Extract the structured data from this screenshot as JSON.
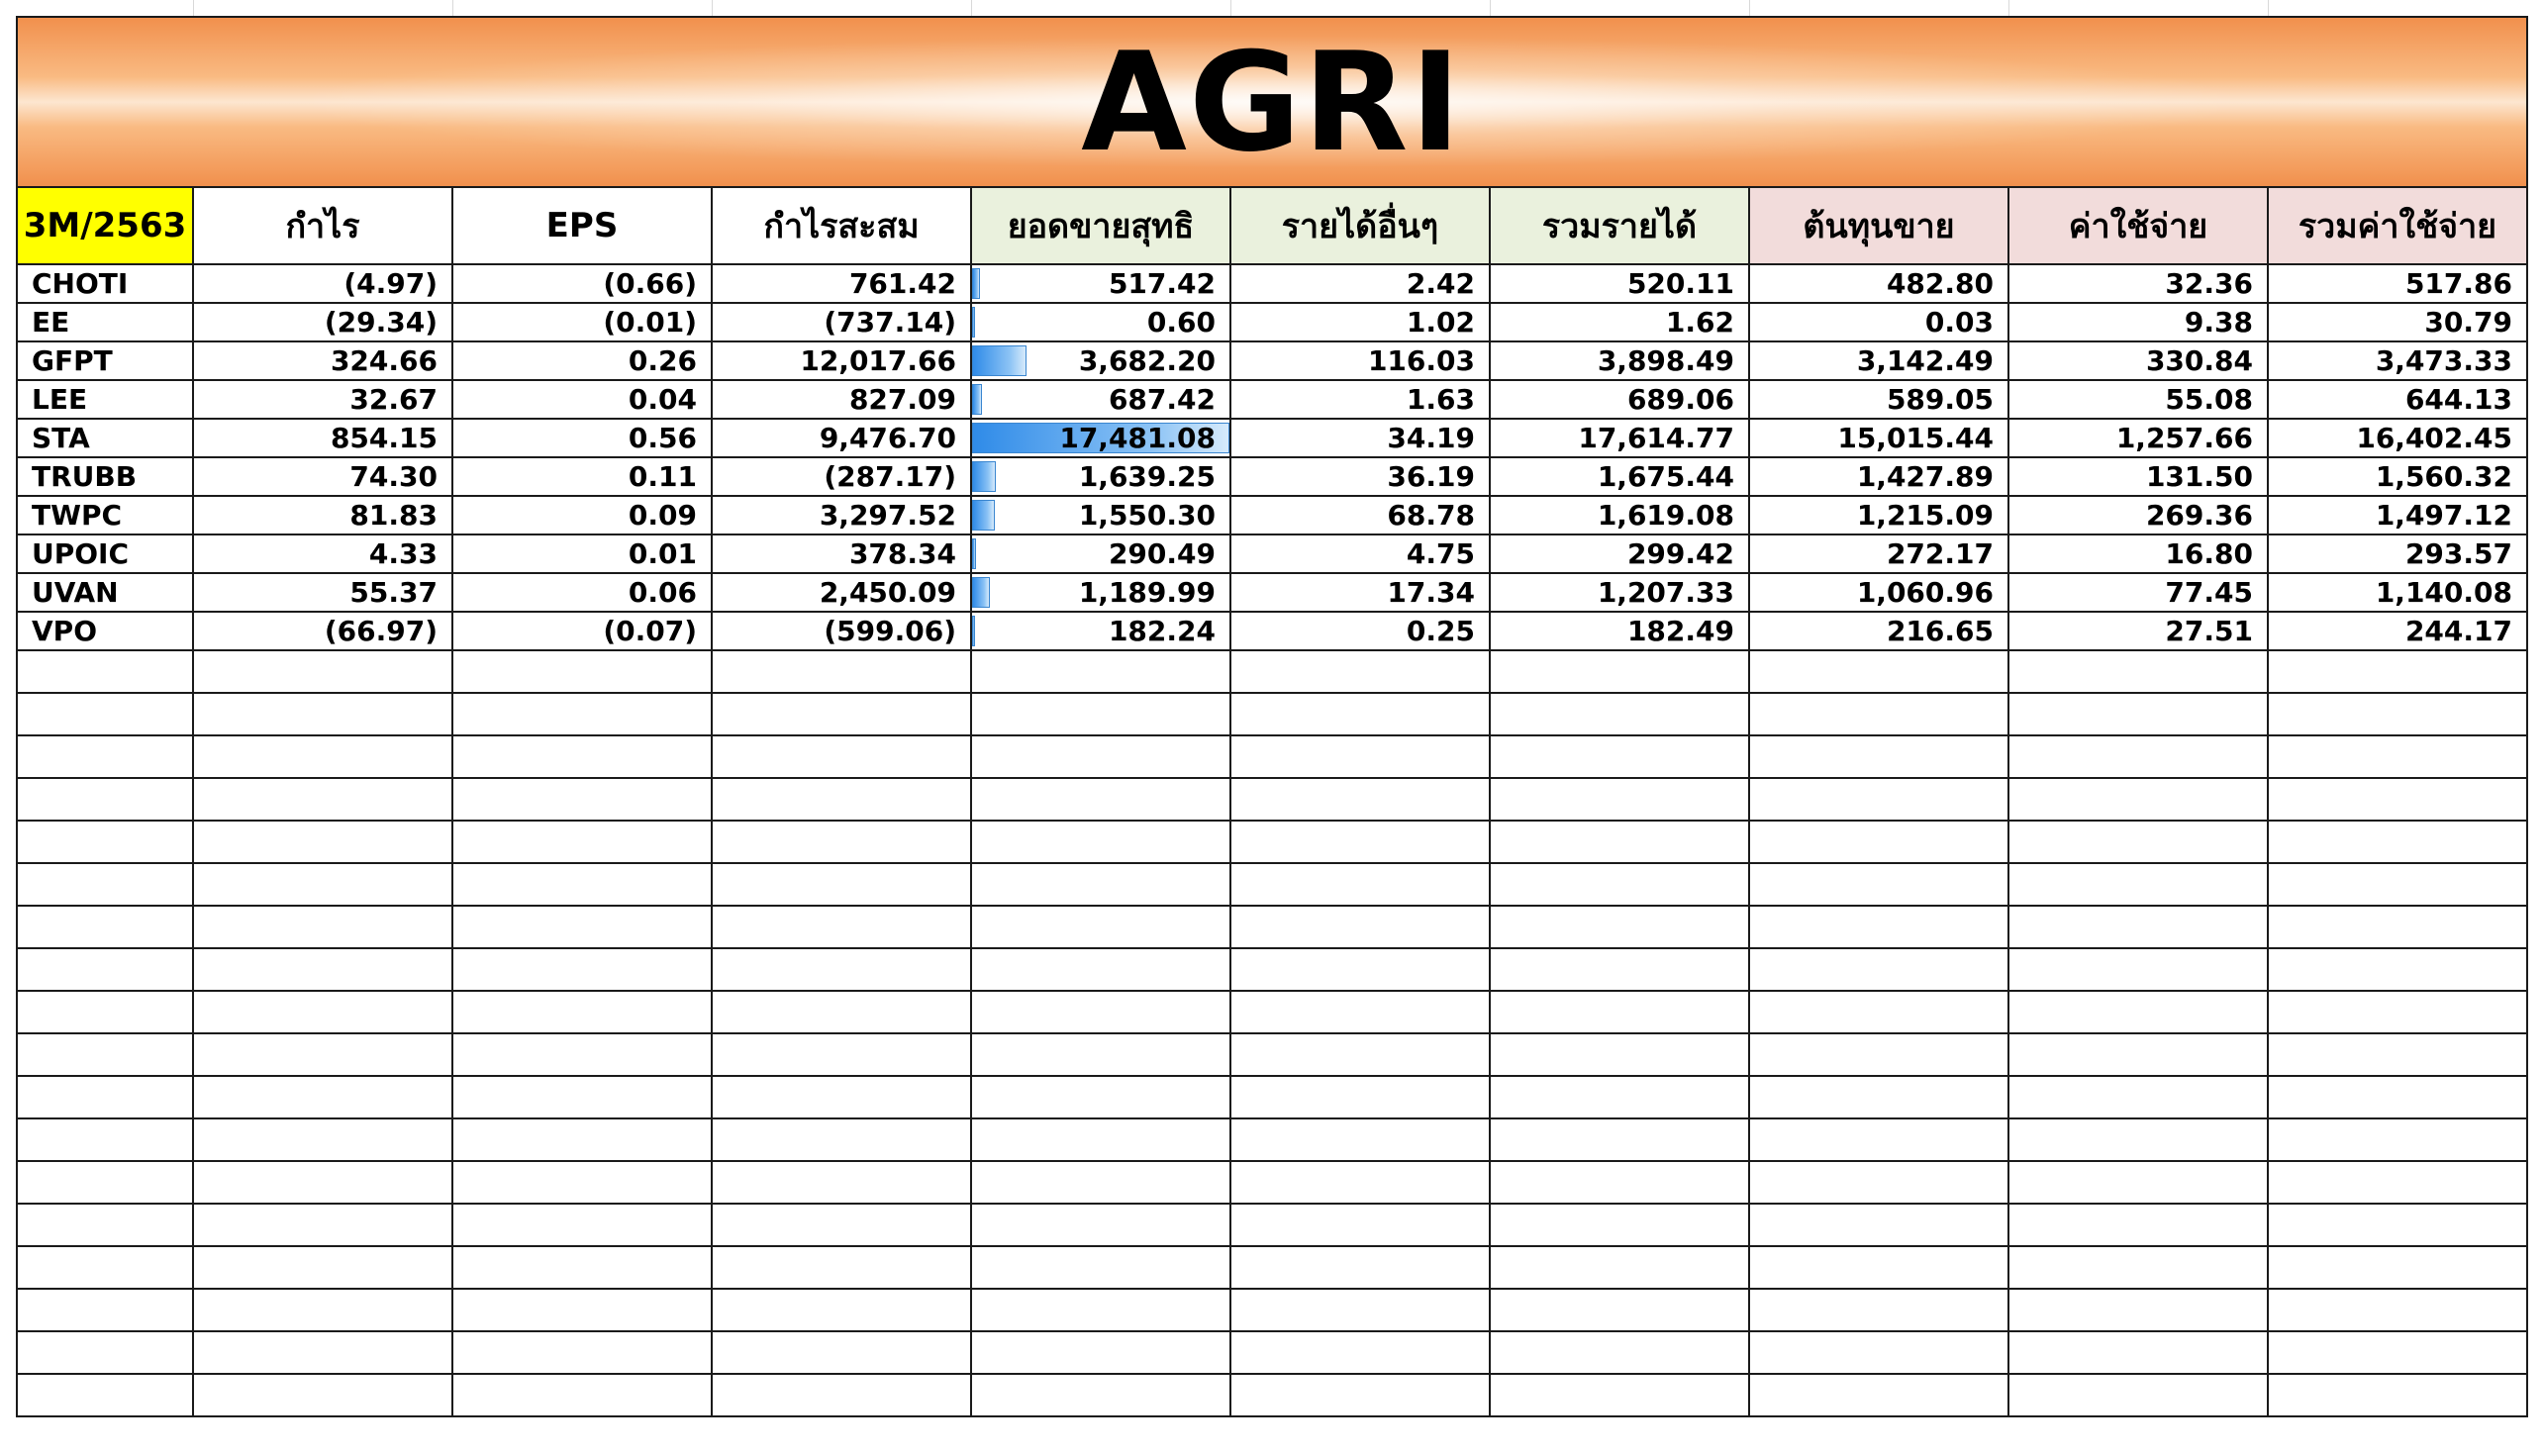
{
  "sheet": {
    "title": "AGRI",
    "period": "3M/2563",
    "headers": [
      "กำไร",
      "EPS",
      "กำไรสะสม",
      "ยอดขายสุทธิ",
      "รายได้อื่นๆ",
      "รวมรายได้",
      "ต้นทุนขาย",
      "ค่าใช้จ่าย",
      "รวมค่าใช้จ่าย"
    ],
    "rows": [
      {
        "symbol": "CHOTI",
        "profit": "(4.97)",
        "eps": "(0.66)",
        "retained": "761.42",
        "sales": "517.42",
        "sales_value": 517.42,
        "other_income": "2.42",
        "total_revenue": "520.11",
        "cost_of_sales": "482.80",
        "expenses": "32.36",
        "total_expenses": "517.86"
      },
      {
        "symbol": "EE",
        "profit": "(29.34)",
        "eps": "(0.01)",
        "retained": "(737.14)",
        "sales": "0.60",
        "sales_value": 0.6,
        "other_income": "1.02",
        "total_revenue": "1.62",
        "cost_of_sales": "0.03",
        "expenses": "9.38",
        "total_expenses": "30.79"
      },
      {
        "symbol": "GFPT",
        "profit": "324.66",
        "eps": "0.26",
        "retained": "12,017.66",
        "sales": "3,682.20",
        "sales_value": 3682.2,
        "other_income": "116.03",
        "total_revenue": "3,898.49",
        "cost_of_sales": "3,142.49",
        "expenses": "330.84",
        "total_expenses": "3,473.33"
      },
      {
        "symbol": "LEE",
        "profit": "32.67",
        "eps": "0.04",
        "retained": "827.09",
        "sales": "687.42",
        "sales_value": 687.42,
        "other_income": "1.63",
        "total_revenue": "689.06",
        "cost_of_sales": "589.05",
        "expenses": "55.08",
        "total_expenses": "644.13"
      },
      {
        "symbol": "STA",
        "profit": "854.15",
        "eps": "0.56",
        "retained": "9,476.70",
        "sales": "17,481.08",
        "sales_value": 17481.08,
        "other_income": "34.19",
        "total_revenue": "17,614.77",
        "cost_of_sales": "15,015.44",
        "expenses": "1,257.66",
        "total_expenses": "16,402.45"
      },
      {
        "symbol": "TRUBB",
        "profit": "74.30",
        "eps": "0.11",
        "retained": "(287.17)",
        "sales": "1,639.25",
        "sales_value": 1639.25,
        "other_income": "36.19",
        "total_revenue": "1,675.44",
        "cost_of_sales": "1,427.89",
        "expenses": "131.50",
        "total_expenses": "1,560.32"
      },
      {
        "symbol": "TWPC",
        "profit": "81.83",
        "eps": "0.09",
        "retained": "3,297.52",
        "sales": "1,550.30",
        "sales_value": 1550.3,
        "other_income": "68.78",
        "total_revenue": "1,619.08",
        "cost_of_sales": "1,215.09",
        "expenses": "269.36",
        "total_expenses": "1,497.12"
      },
      {
        "symbol": "UPOIC",
        "profit": "4.33",
        "eps": "0.01",
        "retained": "378.34",
        "sales": "290.49",
        "sales_value": 290.49,
        "other_income": "4.75",
        "total_revenue": "299.42",
        "cost_of_sales": "272.17",
        "expenses": "16.80",
        "total_expenses": "293.57"
      },
      {
        "symbol": "UVAN",
        "profit": "55.37",
        "eps": "0.06",
        "retained": "2,450.09",
        "sales": "1,189.99",
        "sales_value": 1189.99,
        "other_income": "17.34",
        "total_revenue": "1,207.33",
        "cost_of_sales": "1,060.96",
        "expenses": "77.45",
        "total_expenses": "1,140.08"
      },
      {
        "symbol": "VPO",
        "profit": "(66.97)",
        "eps": "(0.07)",
        "retained": "(599.06)",
        "sales": "182.24",
        "sales_value": 182.24,
        "other_income": "0.25",
        "total_revenue": "182.49",
        "cost_of_sales": "216.65",
        "expenses": "27.51",
        "total_expenses": "244.17"
      }
    ],
    "colors": {
      "title_orange": "#f1904d",
      "period_yellow": "#ffff00",
      "sales_head_green": "#eaf1dd",
      "cost_head_pink": "#f2dcdb",
      "negative_red": "#ff0000",
      "databar_blue": "#2f8be8"
    }
  }
}
